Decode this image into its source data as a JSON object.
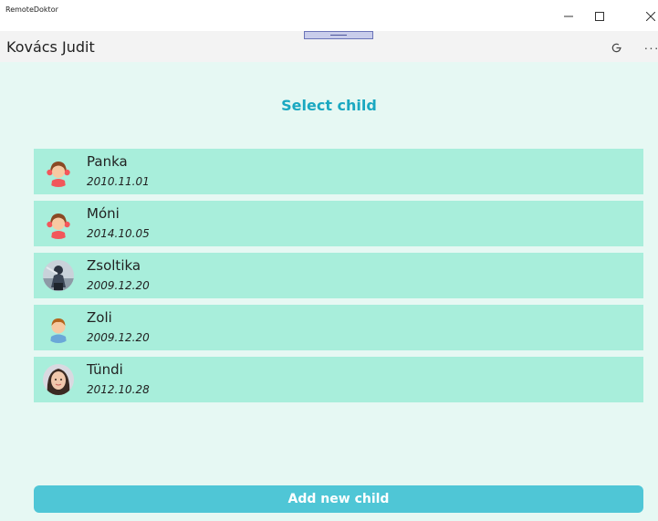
{
  "window": {
    "title": "RemoteDoktor"
  },
  "header": {
    "user_name": "Kovács Judit",
    "more_label": "···"
  },
  "main": {
    "title": "Select child",
    "children": [
      {
        "name": "Panka",
        "birthdate": "2010.11.01",
        "avatar_icon": "girl-avatar-icon"
      },
      {
        "name": "Móni",
        "birthdate": "2014.10.05",
        "avatar_icon": "girl-avatar-icon"
      },
      {
        "name": "Zsoltika",
        "birthdate": "2009.12.20",
        "avatar_icon": "photo-avatar-icon"
      },
      {
        "name": "Zoli",
        "birthdate": "2009.12.20",
        "avatar_icon": "boy-avatar-icon"
      },
      {
        "name": "Tündi",
        "birthdate": "2012.10.28",
        "avatar_icon": "photo-avatar-icon"
      }
    ],
    "add_button_label": "Add new child"
  },
  "colors": {
    "accent": "#1aa8c1",
    "row_background": "#a8eedb",
    "content_background": "#e6f8f3",
    "button_background": "#4fc6d6"
  }
}
